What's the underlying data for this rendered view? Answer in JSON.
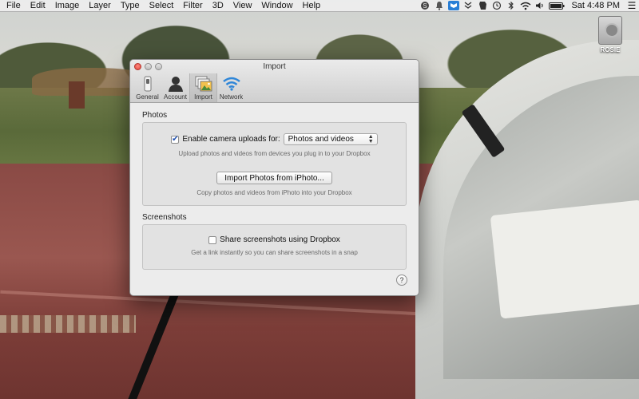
{
  "menubar": {
    "items": [
      "File",
      "Edit",
      "Image",
      "Layer",
      "Type",
      "Select",
      "Filter",
      "3D",
      "View",
      "Window",
      "Help"
    ],
    "status_icons": [
      "skype-icon",
      "notification-icon",
      "dropbox-icon",
      "sync-icon",
      "evernote-icon",
      "time-machine-icon",
      "bluetooth-icon",
      "wifi-icon",
      "volume-icon",
      "battery-icon"
    ],
    "clock": "Sat 4:48 PM"
  },
  "desktop": {
    "drive_label": "ROSIE"
  },
  "window": {
    "title": "Import",
    "toolbar": [
      {
        "label": "General",
        "icon": "switch-icon"
      },
      {
        "label": "Account",
        "icon": "person-icon"
      },
      {
        "label": "Import",
        "icon": "photos-icon"
      },
      {
        "label": "Network",
        "icon": "wifi-icon"
      }
    ],
    "active_tab": "Import",
    "photos": {
      "section_title": "Photos",
      "camera_checkbox_label": "Enable camera uploads for:",
      "camera_checked": true,
      "camera_select_value": "Photos and videos",
      "camera_hint": "Upload photos and videos from devices you plug in to your Dropbox",
      "iphoto_button": "Import Photos from iPhoto...",
      "iphoto_hint": "Copy photos and videos from iPhoto into your Dropbox"
    },
    "screenshots": {
      "section_title": "Screenshots",
      "share_checkbox_label": "Share screenshots using Dropbox",
      "share_checked": false,
      "share_hint": "Get a link instantly so you can share screenshots in a snap"
    },
    "help_label": "?"
  }
}
